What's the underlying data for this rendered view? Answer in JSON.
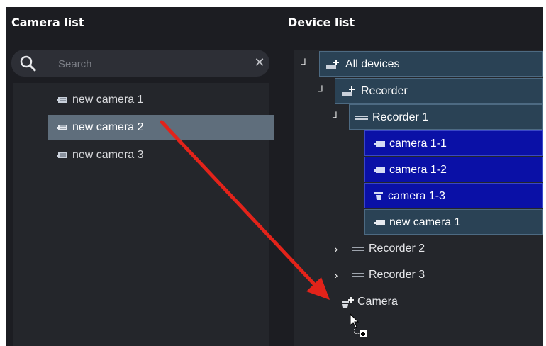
{
  "left": {
    "title": "Camera list",
    "search": {
      "placeholder": "Search"
    },
    "cameras": [
      {
        "label": "new camera 1"
      },
      {
        "label": "new camera 2",
        "selected": true
      },
      {
        "label": "new camera 3"
      }
    ]
  },
  "right": {
    "title": "Device list",
    "tree": {
      "all_devices": "All devices",
      "recorder_group": "Recorder",
      "recorder1": "Recorder 1",
      "cameras": [
        "camera 1-1",
        "camera 1-2",
        "camera 1-3",
        "new camera 1"
      ],
      "recorder2": "Recorder 2",
      "recorder3": "Recorder 3",
      "camera_group": "Camera"
    }
  },
  "colors": {
    "background": "#1c1d22",
    "selected_row": "#5f6e7c",
    "tree_frame": "#2a4255",
    "camera_highlight": "#0a10a6",
    "drag_arrow": "#e2231a"
  },
  "icons": {
    "search": "search-icon",
    "clear": "close-icon",
    "camera": "camera-icon",
    "recorder": "recorder-icon",
    "add_device": "add-device-icon",
    "expanded": "chevron-expanded-icon",
    "collapsed": "chevron-right-icon",
    "drag_cursor": "drag-add-cursor-icon"
  }
}
